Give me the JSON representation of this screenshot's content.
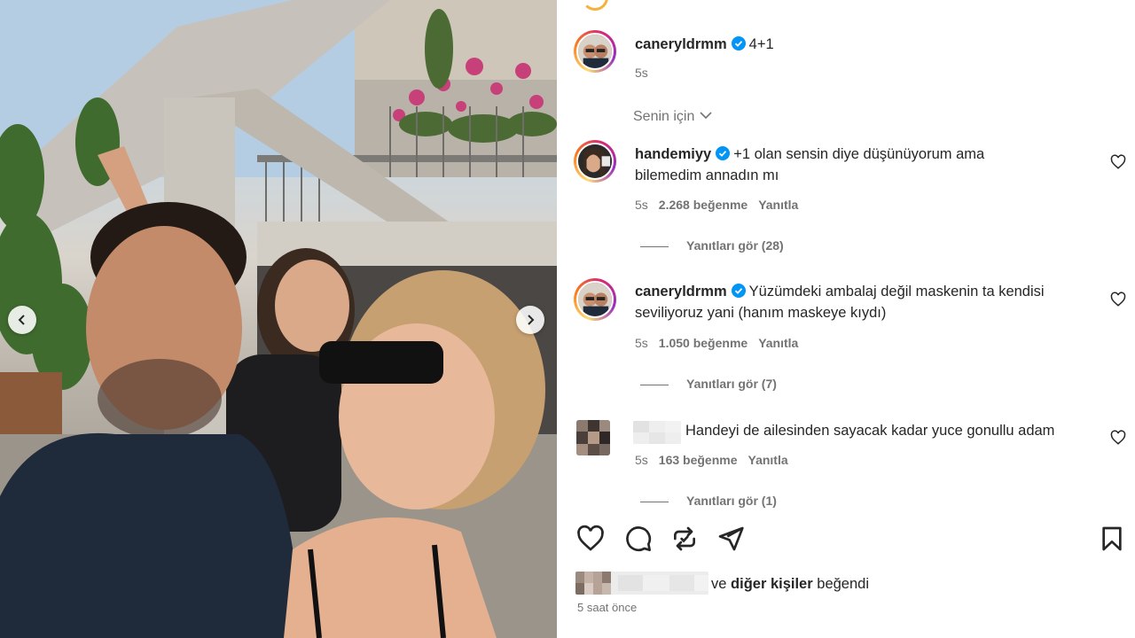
{
  "post": {
    "author": "caneryldrmm",
    "caption": "4+1",
    "time": "5s",
    "filter_label": "Senin için"
  },
  "comments": [
    {
      "user": "handemiyy",
      "lines": [
        "+1 olan sensin diye düşünüyorum ama",
        "bilemedim annadın mı"
      ],
      "time": "5s",
      "likes": "2.268 beğenme",
      "reply": "Yanıtla",
      "view_replies": "Yanıtları gör (28)"
    },
    {
      "user": "caneryldrmm",
      "lines": [
        "Yüzümdeki ambalaj değil maskenin ta kendisi",
        "seviliyoruz yani (hanım maskeye kıydı)"
      ],
      "time": "5s",
      "likes": "1.050 beğenme",
      "reply": "Yanıtla",
      "view_replies": "Yanıtları gör (7)"
    },
    {
      "user": "",
      "lines": [
        "Handeyi de ailesinden sayacak kadar yuce gonullu adam"
      ],
      "time": "5s",
      "likes": "163 beğenme",
      "reply": "Yanıtla",
      "view_replies": "Yanıtları gör (1)"
    }
  ],
  "footer": {
    "likes_prefix": "ve",
    "likes_bold": "diğer kişiler",
    "likes_suffix": "beğendi",
    "timestamp": "5 saat önce"
  },
  "icons": {
    "like": "heart-icon",
    "comment": "comment-icon",
    "share": "repost-icon",
    "send": "send-icon",
    "save": "bookmark-icon",
    "verified": "verified-badge-icon",
    "prev": "chevron-left-icon",
    "next": "chevron-right-icon"
  },
  "colors": {
    "verified_blue": "#0095f6",
    "text": "#262626",
    "muted": "#737373"
  }
}
